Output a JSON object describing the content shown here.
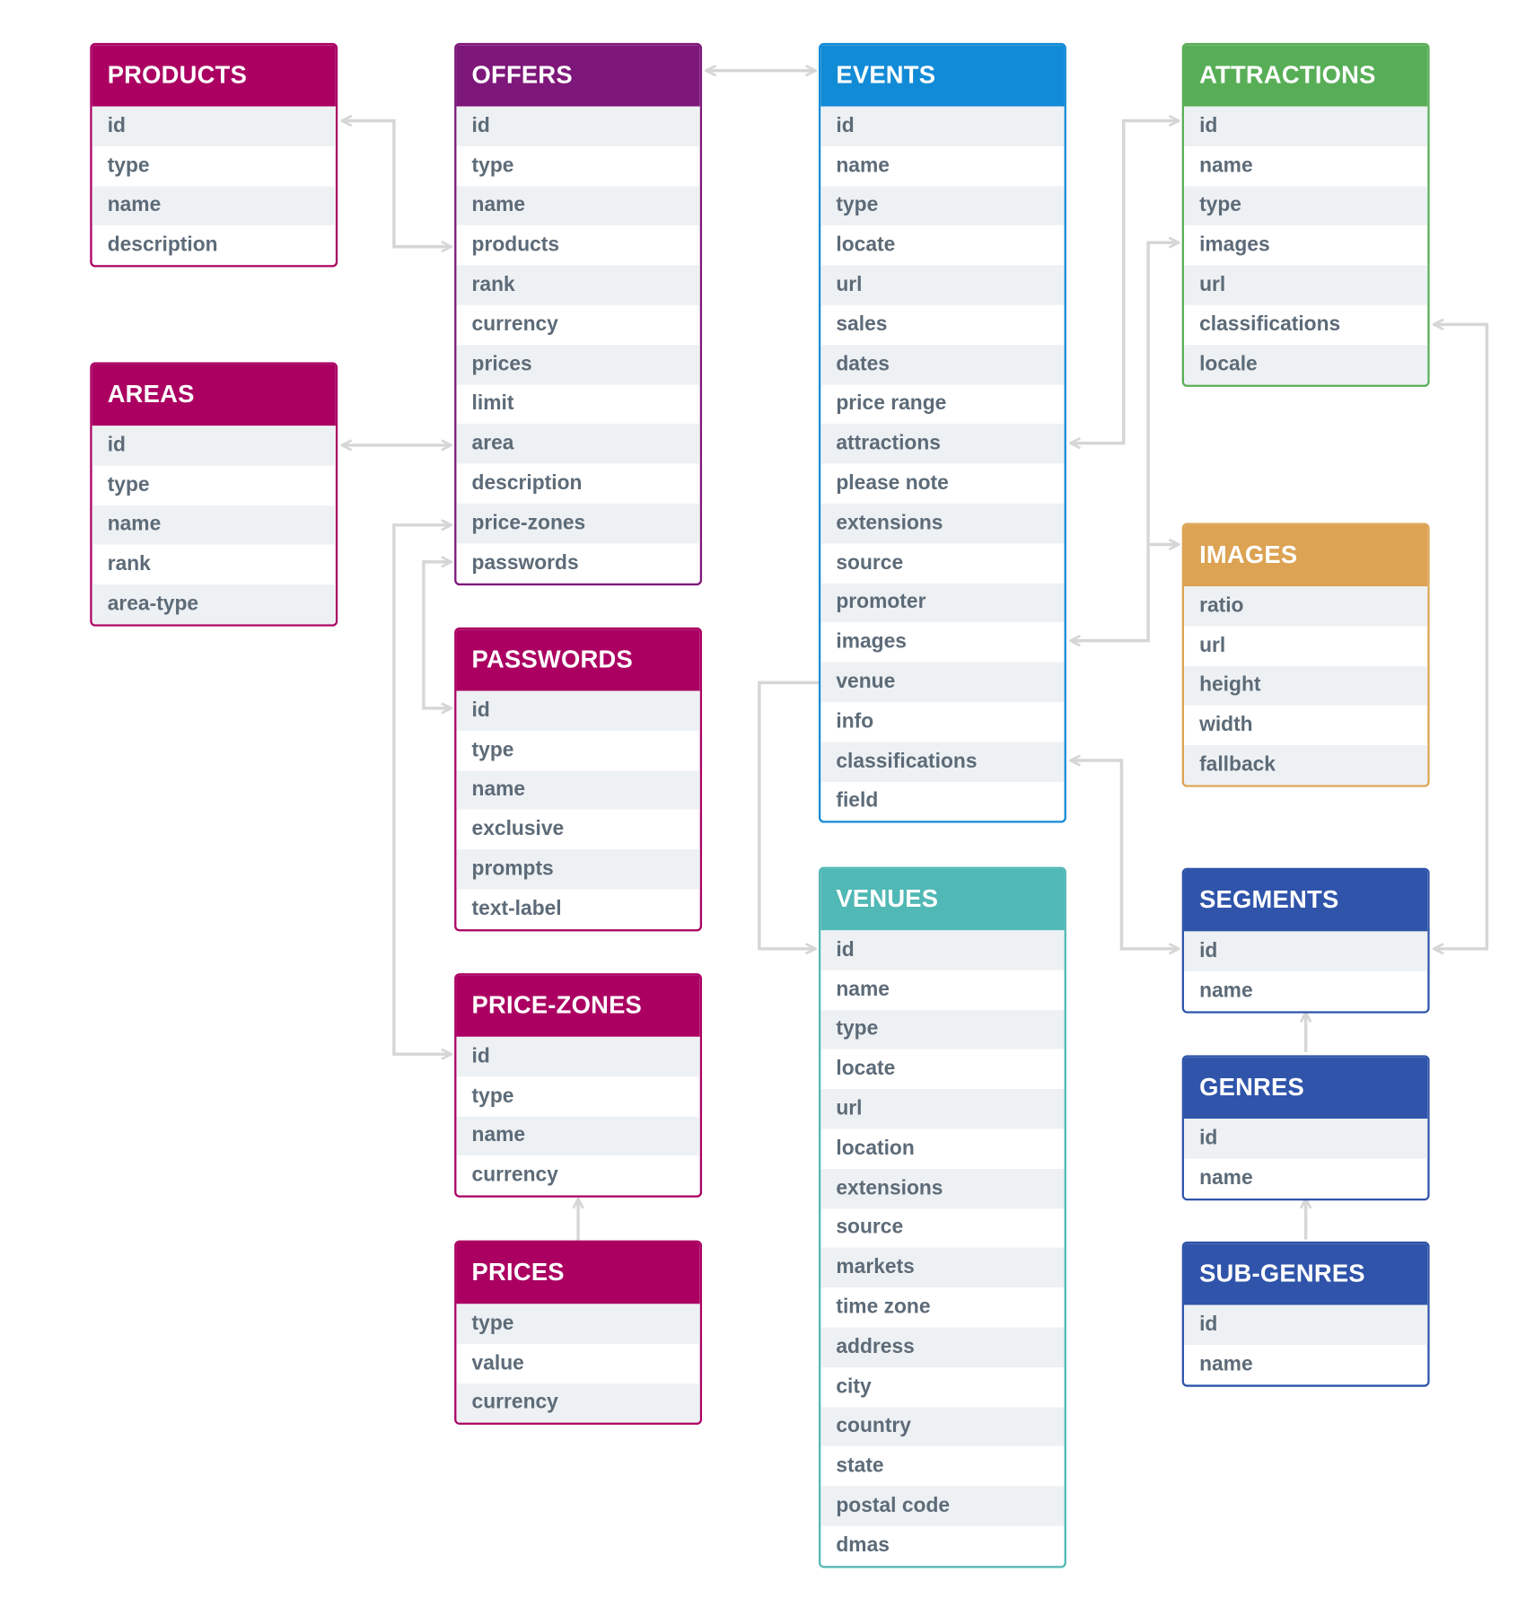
{
  "colors": {
    "connector": "#d6d6d6",
    "row_alt": "#eef1f4",
    "text": "#5d6b78"
  },
  "tables": [
    {
      "key": "products",
      "title": "PRODUCTS",
      "color": "#ab0062",
      "fields": [
        "id",
        "type",
        "name",
        "description"
      ]
    },
    {
      "key": "areas",
      "title": "AREAS",
      "color": "#ab0062",
      "fields": [
        "id",
        "type",
        "name",
        "rank",
        "area-type"
      ]
    },
    {
      "key": "offers",
      "title": "OFFERS",
      "color": "#7e177a",
      "fields": [
        "id",
        "type",
        "name",
        "products",
        "rank",
        "currency",
        "prices",
        "limit",
        "area",
        "description",
        "price-zones",
        "passwords"
      ]
    },
    {
      "key": "passwords",
      "title": "PASSWORDS",
      "color": "#ab0062",
      "fields": [
        "id",
        "type",
        "name",
        "exclusive",
        "prompts",
        "text-label"
      ]
    },
    {
      "key": "price-zones",
      "title": "PRICE-ZONES",
      "color": "#ab0062",
      "fields": [
        "id",
        "type",
        "name",
        "currency"
      ]
    },
    {
      "key": "prices",
      "title": "PRICES",
      "color": "#ab0062",
      "fields": [
        "type",
        "value",
        "currency"
      ]
    },
    {
      "key": "events",
      "title": "EVENTS",
      "color": "#128bd7",
      "fields": [
        "id",
        "name",
        "type",
        "locate",
        "url",
        "sales",
        "dates",
        "price range",
        "attractions",
        "please note",
        "extensions",
        "source",
        "promoter",
        "images",
        "venue",
        "info",
        "classifications",
        "field"
      ]
    },
    {
      "key": "venues",
      "title": "VENUES",
      "color": "#50b8b5",
      "fields": [
        "id",
        "name",
        "type",
        "locate",
        "url",
        "location",
        "extensions",
        "source",
        "markets",
        "time zone",
        "address",
        "city",
        "country",
        "state",
        "postal code",
        "dmas"
      ]
    },
    {
      "key": "attractions",
      "title": "ATTRACTIONS",
      "color": "#58ae57",
      "fields": [
        "id",
        "name",
        "type",
        "images",
        "url",
        "classifications",
        "locale"
      ]
    },
    {
      "key": "images",
      "title": "IMAGES",
      "color": "#dca353",
      "fields": [
        "ratio",
        "url",
        "height",
        "width",
        "fallback"
      ]
    },
    {
      "key": "segments",
      "title": "SEGMENTS",
      "color": "#2f54aa",
      "fields": [
        "id",
        "name"
      ]
    },
    {
      "key": "genres",
      "title": "GENRES",
      "color": "#2f54aa",
      "fields": [
        "id",
        "name"
      ]
    },
    {
      "key": "sub-genres",
      "title": "SUB-GENRES",
      "color": "#2f54aa",
      "fields": [
        "id",
        "name"
      ]
    }
  ],
  "relations": [
    {
      "from": "offers.products",
      "to": "products.id"
    },
    {
      "from": "offers",
      "to": "events"
    },
    {
      "from": "offers.area",
      "to": "areas.id"
    },
    {
      "from": "offers.price-zones",
      "to": "price-zones.id"
    },
    {
      "from": "offers.passwords",
      "to": "passwords.id"
    },
    {
      "from": "prices",
      "to": "price-zones"
    },
    {
      "from": "events.attractions",
      "to": "attractions.id"
    },
    {
      "from": "events.images",
      "to": "images"
    },
    {
      "from": "attractions.images",
      "to": "images"
    },
    {
      "from": "events.venue",
      "to": "venues.id"
    },
    {
      "from": "events.classifications",
      "to": "segments.id"
    },
    {
      "from": "attractions.classifications",
      "to": "segments.id"
    },
    {
      "from": "genres",
      "to": "segments"
    },
    {
      "from": "sub-genres",
      "to": "genres"
    }
  ]
}
